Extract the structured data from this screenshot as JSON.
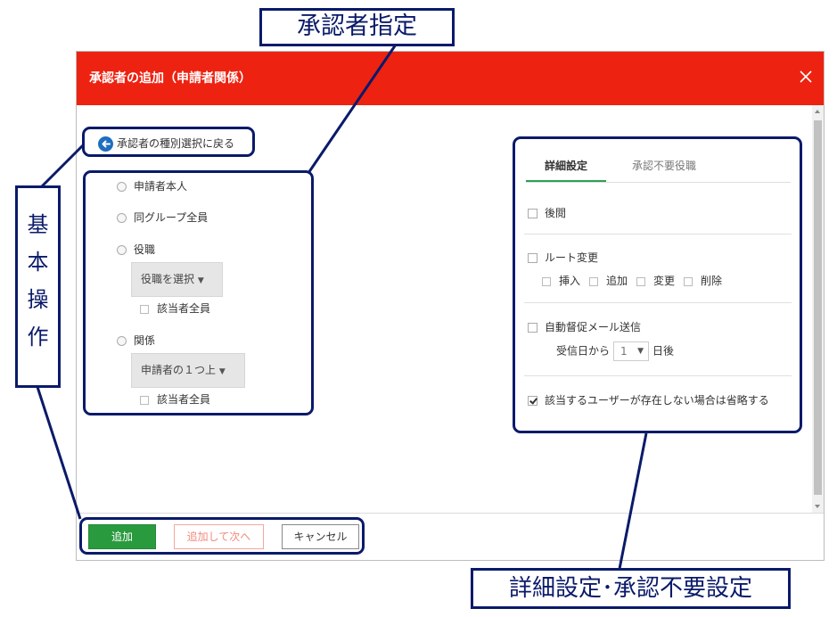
{
  "dialog": {
    "title": "承認者の追加（申請者関係）",
    "header_color": "#ee2211",
    "close_icon": "close-icon"
  },
  "left": {
    "back_link_label": "承認者の種別選択に戻る",
    "back_icon": "arrow-left-circle-icon",
    "options": {
      "applicant_self": "申請者本人",
      "same_group_all": "同グループ全員",
      "position": "役職",
      "relation": "関係"
    },
    "position_select": "役職を選択",
    "position_all_label": "該当者全員",
    "relation_select": "申請者の１つ上",
    "relation_all_label": "該当者全員"
  },
  "right": {
    "tabs": [
      {
        "label": "詳細設定",
        "active": true
      },
      {
        "label": "承認不要役職",
        "active": false
      }
    ],
    "review_label": "後閲",
    "route_change_label": "ルート変更",
    "route_options": [
      "挿入",
      "追加",
      "変更",
      "削除"
    ],
    "reminder_label": "自動督促メール送信",
    "reminder_prefix": "受信日から",
    "reminder_days": "1",
    "reminder_suffix": "日後",
    "skip_label": "該当するユーザーが存在しない場合は省略する",
    "skip_checked": true
  },
  "footer": {
    "add_label": "追加",
    "add_next_label": "追加して次へ",
    "cancel_label": "キャンセル",
    "accent": "#2a9a3e"
  },
  "annotations": {
    "approver_label": "承認者指定",
    "basic_ops_label": [
      "基",
      "本",
      "操",
      "作"
    ],
    "detail_label": "詳細設定･承認不要設定",
    "color": "#0a1a6a"
  }
}
